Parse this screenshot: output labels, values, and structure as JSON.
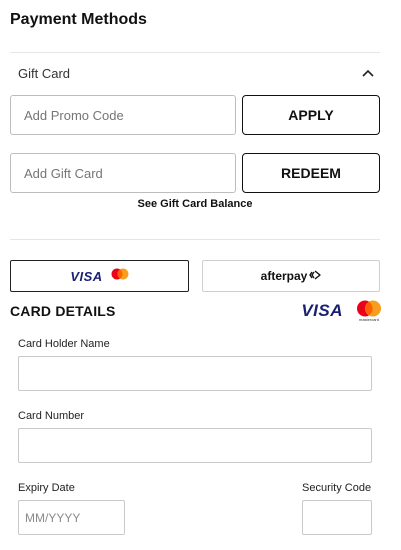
{
  "page": {
    "title": "Payment Methods"
  },
  "gift_card": {
    "header_label": "Gift Card",
    "promo": {
      "placeholder": "Add Promo Code",
      "button_label": "APPLY"
    },
    "gift": {
      "placeholder": "Add Gift Card",
      "button_label": "REDEEM"
    },
    "balance_link": "See Gift Card Balance"
  },
  "payment_options": {
    "card_visa_label": "VISA",
    "afterpay_label": "afterpay"
  },
  "card_details": {
    "title": "CARD DETAILS",
    "visa_logo_label": "VISA",
    "mastercard_logo_label": "mastercard",
    "fields": {
      "holder_name": {
        "label": "Card Holder Name",
        "value": ""
      },
      "card_number": {
        "label": "Card Number",
        "value": ""
      },
      "expiry": {
        "label": "Expiry Date",
        "placeholder": "MM/YYYY"
      },
      "security_code": {
        "label": "Security Code",
        "value": ""
      }
    }
  },
  "icons": [
    "chevron-up-icon",
    "visa-icon",
    "mastercard-icon",
    "afterpay-icon"
  ],
  "colors": {
    "visa_blue": "#1a1f71",
    "mastercard_red": "#eb001b",
    "mastercard_orange": "#f79e1b",
    "mastercard_overlap": "#ff5f00"
  }
}
